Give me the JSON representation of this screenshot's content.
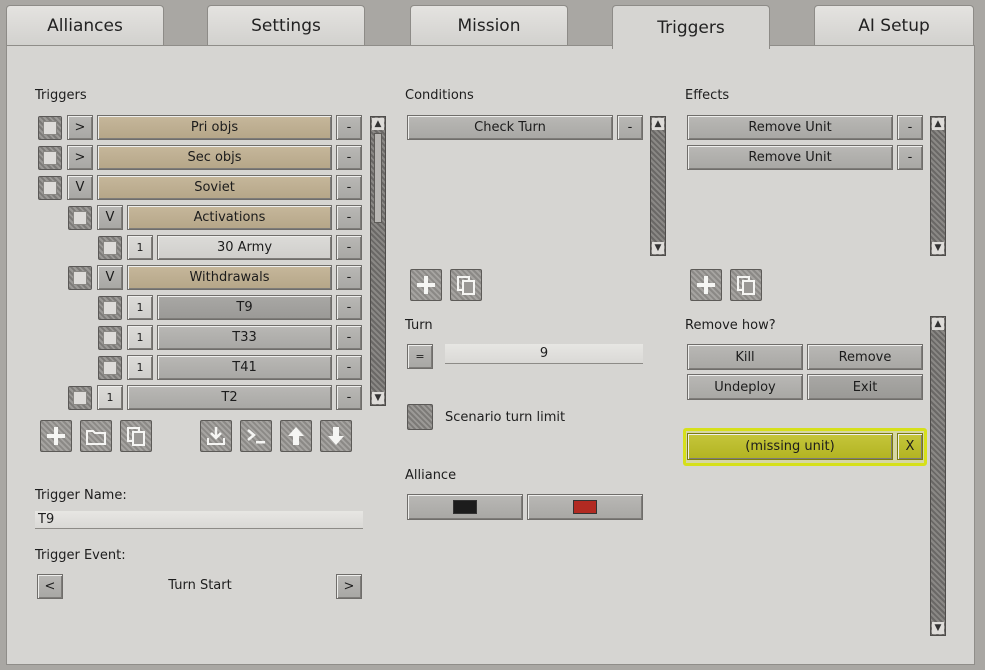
{
  "tabs": [
    {
      "label": "Alliances"
    },
    {
      "label": "Settings"
    },
    {
      "label": "Mission"
    },
    {
      "label": "Triggers"
    },
    {
      "label": "AI Setup"
    }
  ],
  "active_tab": "Triggers",
  "triggers": {
    "label": "Triggers",
    "items": [
      {
        "toggle": ">",
        "name": "Pri objs",
        "remove": "-"
      },
      {
        "toggle": ">",
        "name": "Sec objs",
        "remove": "-"
      },
      {
        "toggle": "V",
        "name": "Soviet",
        "remove": "-"
      },
      {
        "toggle": "V",
        "name": "Activations",
        "remove": "-"
      },
      {
        "toggle": "1",
        "name": "30 Army",
        "remove": "-"
      },
      {
        "toggle": "V",
        "name": "Withdrawals",
        "remove": "-"
      },
      {
        "toggle": "1",
        "name": "T9",
        "remove": "-"
      },
      {
        "toggle": "1",
        "name": "T33",
        "remove": "-"
      },
      {
        "toggle": "1",
        "name": "T41",
        "remove": "-"
      },
      {
        "toggle": "1",
        "name": "T2",
        "remove": "-"
      }
    ]
  },
  "trigger_name": {
    "label": "Trigger Name:",
    "value": "T9"
  },
  "trigger_event": {
    "label": "Trigger Event:",
    "value": "Turn Start",
    "prev": "<",
    "next": ">"
  },
  "conditions": {
    "label": "Conditions",
    "items": [
      {
        "name": "Check Turn",
        "remove": "-"
      }
    ]
  },
  "turn": {
    "label": "Turn",
    "operator": "=",
    "value": "9"
  },
  "scenario_turn_limit": "Scenario turn limit",
  "alliance": {
    "label": "Alliance",
    "colors": [
      "#1c1c1c",
      "#b22a22"
    ]
  },
  "effects": {
    "label": "Effects",
    "items": [
      {
        "name": "Remove Unit",
        "remove": "-"
      },
      {
        "name": "Remove Unit",
        "remove": "-"
      }
    ]
  },
  "remove_how": {
    "label": "Remove how?",
    "options": [
      "Kill",
      "Remove",
      "Undeploy",
      "Exit"
    ]
  },
  "missing_unit": {
    "label": "(missing unit)",
    "close": "X"
  },
  "icons": {
    "add": "plus-icon",
    "duplicate": "copy-icon",
    "folder": "folder-icon",
    "import": "import-icon",
    "console": "console-icon",
    "up": "arrow-up-icon",
    "down": "arrow-down-icon"
  }
}
